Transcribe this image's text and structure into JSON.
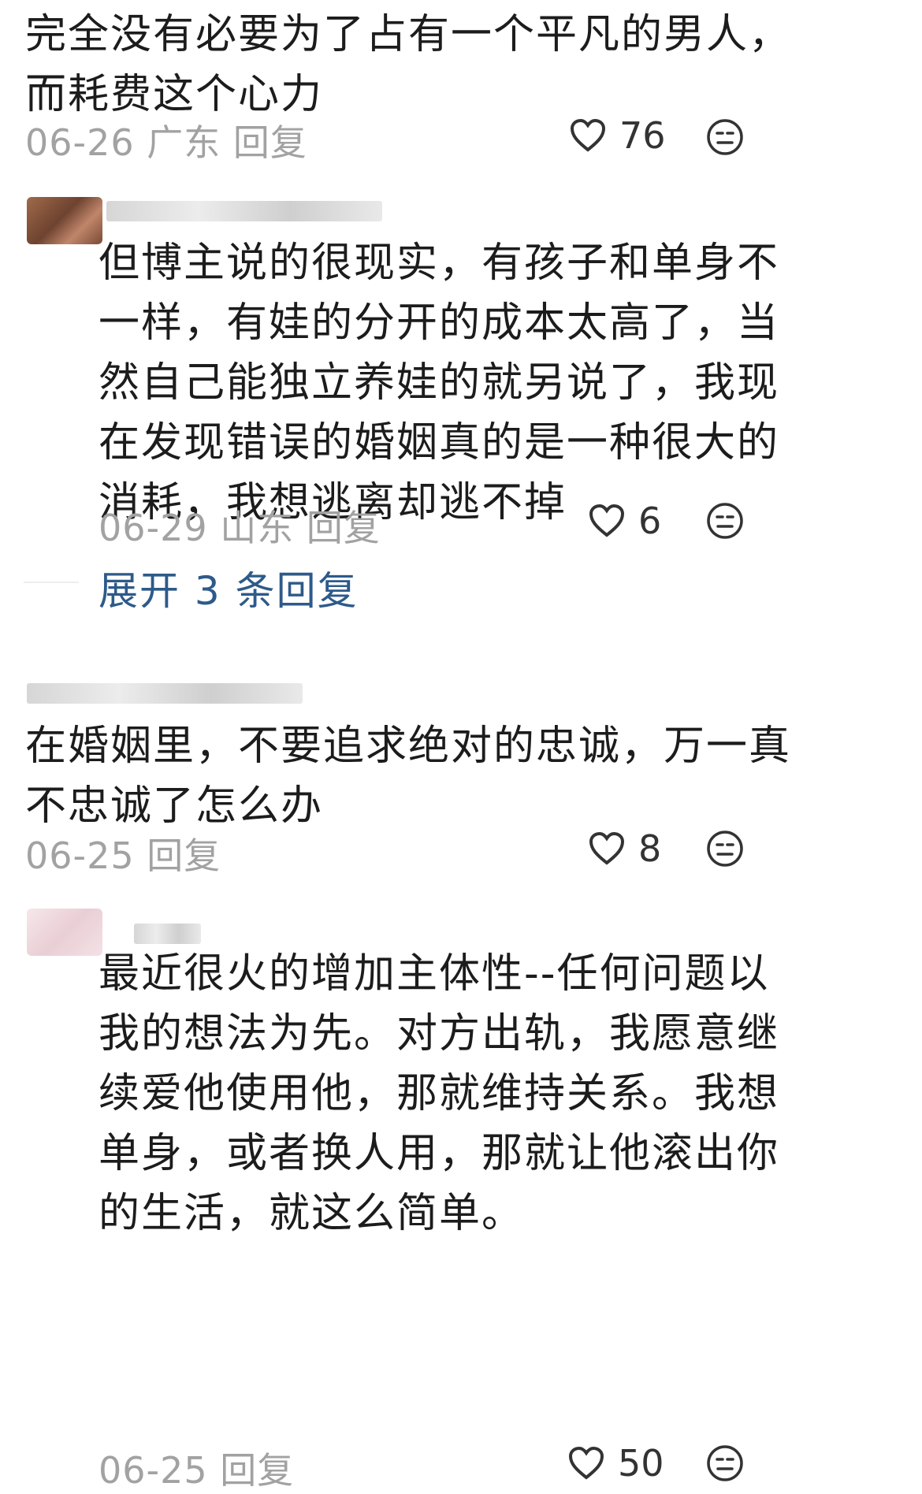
{
  "comments": [
    {
      "lines": [
        "完全没有必要为了占有一个平凡的男人，",
        "而耗费这个心力"
      ],
      "meta": "06-26 广东 回复",
      "likes": "76"
    },
    {
      "lines": [
        "但博主说的很现实，有孩子和单身不",
        "一样，有娃的分开的成本太高了，当",
        "然自己能独立养娃的就另说了，我现",
        "在发现错误的婚姻真的是一种很大的",
        "消耗，我想逃离却逃不掉"
      ],
      "meta": "06-29 山东 回复",
      "likes": "6",
      "expand": "展开 3 条回复"
    },
    {
      "lines": [
        "在婚姻里，不要追求绝对的忠诚，万一真",
        "不忠诚了怎么办"
      ],
      "meta": "06-25 回复",
      "likes": "8"
    },
    {
      "lines": [
        "最近很火的增加主体性--任何问题以",
        "我的想法为先。对方出轨，我愿意继",
        "续爱他使用他，那就维持关系。我想",
        "单身，或者换人用，那就让他滚出你",
        "的生活，就这么简单。"
      ],
      "meta": "06-25 回复",
      "likes": "50"
    }
  ]
}
